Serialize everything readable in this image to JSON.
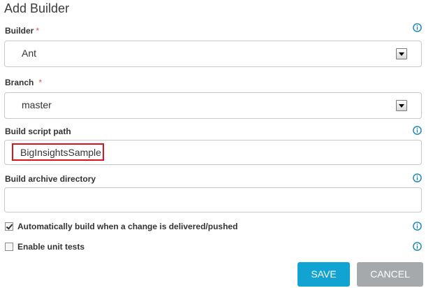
{
  "dialog": {
    "title": "Add Builder"
  },
  "builder": {
    "label": "Builder",
    "required": "*",
    "value": "Ant"
  },
  "branch": {
    "label": "Branch",
    "required": "*",
    "value": "master"
  },
  "build_script_path": {
    "label": "Build script path",
    "value": "BigInsightsSample"
  },
  "build_archive_directory": {
    "label": "Build archive directory",
    "value": ""
  },
  "auto_build": {
    "label": "Automatically build when a change is delivered/pushed",
    "checked": true
  },
  "unit_tests": {
    "label": "Enable unit tests",
    "checked": false
  },
  "buttons": {
    "save": "SAVE",
    "cancel": "CANCEL"
  },
  "colors": {
    "accent": "#11a3d2",
    "required": "#d9534f",
    "highlight": "#d9141f",
    "cancel": "#a6a9ab"
  },
  "icons": {
    "info": "info-icon",
    "dropdown": "chevron-down-icon"
  }
}
